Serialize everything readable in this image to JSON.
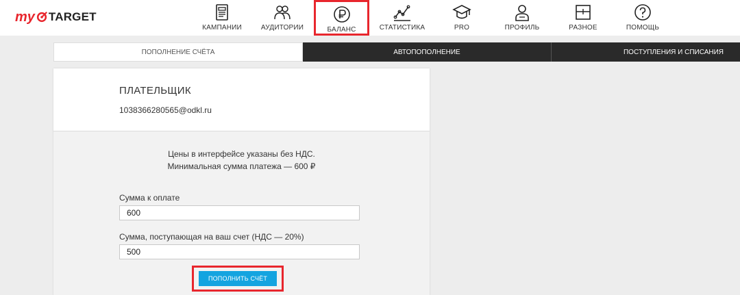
{
  "brand": {
    "my": "my",
    "target": "TARGET",
    "accent": "#e8262d"
  },
  "nav": [
    {
      "label": "КАМПАНИИ",
      "icon": "document-icon"
    },
    {
      "label": "АУДИТОРИИ",
      "icon": "audience-icon"
    },
    {
      "label": "БАЛАНС",
      "icon": "ruble-icon",
      "active": true
    },
    {
      "label": "СТАТИСТИКА",
      "icon": "chart-icon"
    },
    {
      "label": "PRO",
      "icon": "graduation-cap-icon"
    },
    {
      "label": "ПРОФИЛЬ",
      "icon": "person-icon"
    },
    {
      "label": "РАЗНОЕ",
      "icon": "grid-icon"
    },
    {
      "label": "ПОМОЩЬ",
      "icon": "help-icon"
    }
  ],
  "tabs": [
    {
      "label": "ПОПОЛНЕНИЕ СЧЁТА",
      "active": true
    },
    {
      "label": "АВТОПОПОЛНЕНИЕ"
    },
    {
      "label": "ПОСТУПЛЕНИЯ И СПИСАНИЯ"
    }
  ],
  "payer": {
    "title": "ПЛАТЕЛЬЩИК",
    "email": "1038366280565@odkl.ru"
  },
  "note": {
    "line1": "Цены в интерфейсе указаны без НДС.",
    "line2": "Минимальная сумма платежа — 600 ₽"
  },
  "form": {
    "amount_label": "Сумма к оплате",
    "amount_value": "600",
    "received_label": "Сумма, поступающая на ваш счет (НДС — 20%)",
    "received_value": "500",
    "submit_label": "ПОПОЛНИТЬ СЧЁТ",
    "submit_color": "#14a4e0"
  }
}
